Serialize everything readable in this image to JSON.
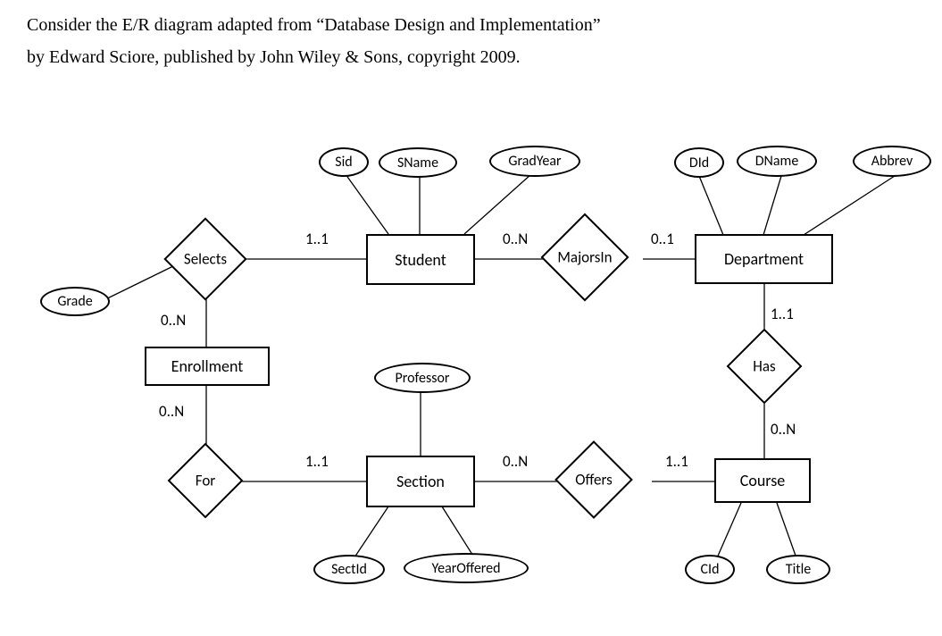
{
  "intro": {
    "line1": "Consider the E/R diagram adapted from “Database Design and Implementation”",
    "line2": "by Edward Sciore, published by John Wiley & Sons, copyright 2009."
  },
  "entities": {
    "student": "Student",
    "department": "Department",
    "enrollment": "Enrollment",
    "section": "Section",
    "course": "Course"
  },
  "relationships": {
    "selects": "Selects",
    "majorsin": "MajorsIn",
    "for": "For",
    "offers": "Offers",
    "has": "Has"
  },
  "attributes": {
    "sid": "Sid",
    "sname": "SName",
    "gradyear": "GradYear",
    "did": "DId",
    "dname": "DName",
    "abbrev": "Abbrev",
    "grade": "Grade",
    "professor": "Professor",
    "sectid": "SectId",
    "yearoffered": "YearOffered",
    "cid": "CId",
    "title": "Title"
  },
  "cardinalities": {
    "selects_student": "1..1",
    "student_majorsin": "0..N",
    "majorsin_department": "0..1",
    "selects_enrollment": "0..N",
    "enrollment_for": "0..N",
    "for_section": "1..1",
    "section_offers": "0..N",
    "offers_course": "1..1",
    "department_has": "1..1",
    "has_course": "0..N"
  }
}
